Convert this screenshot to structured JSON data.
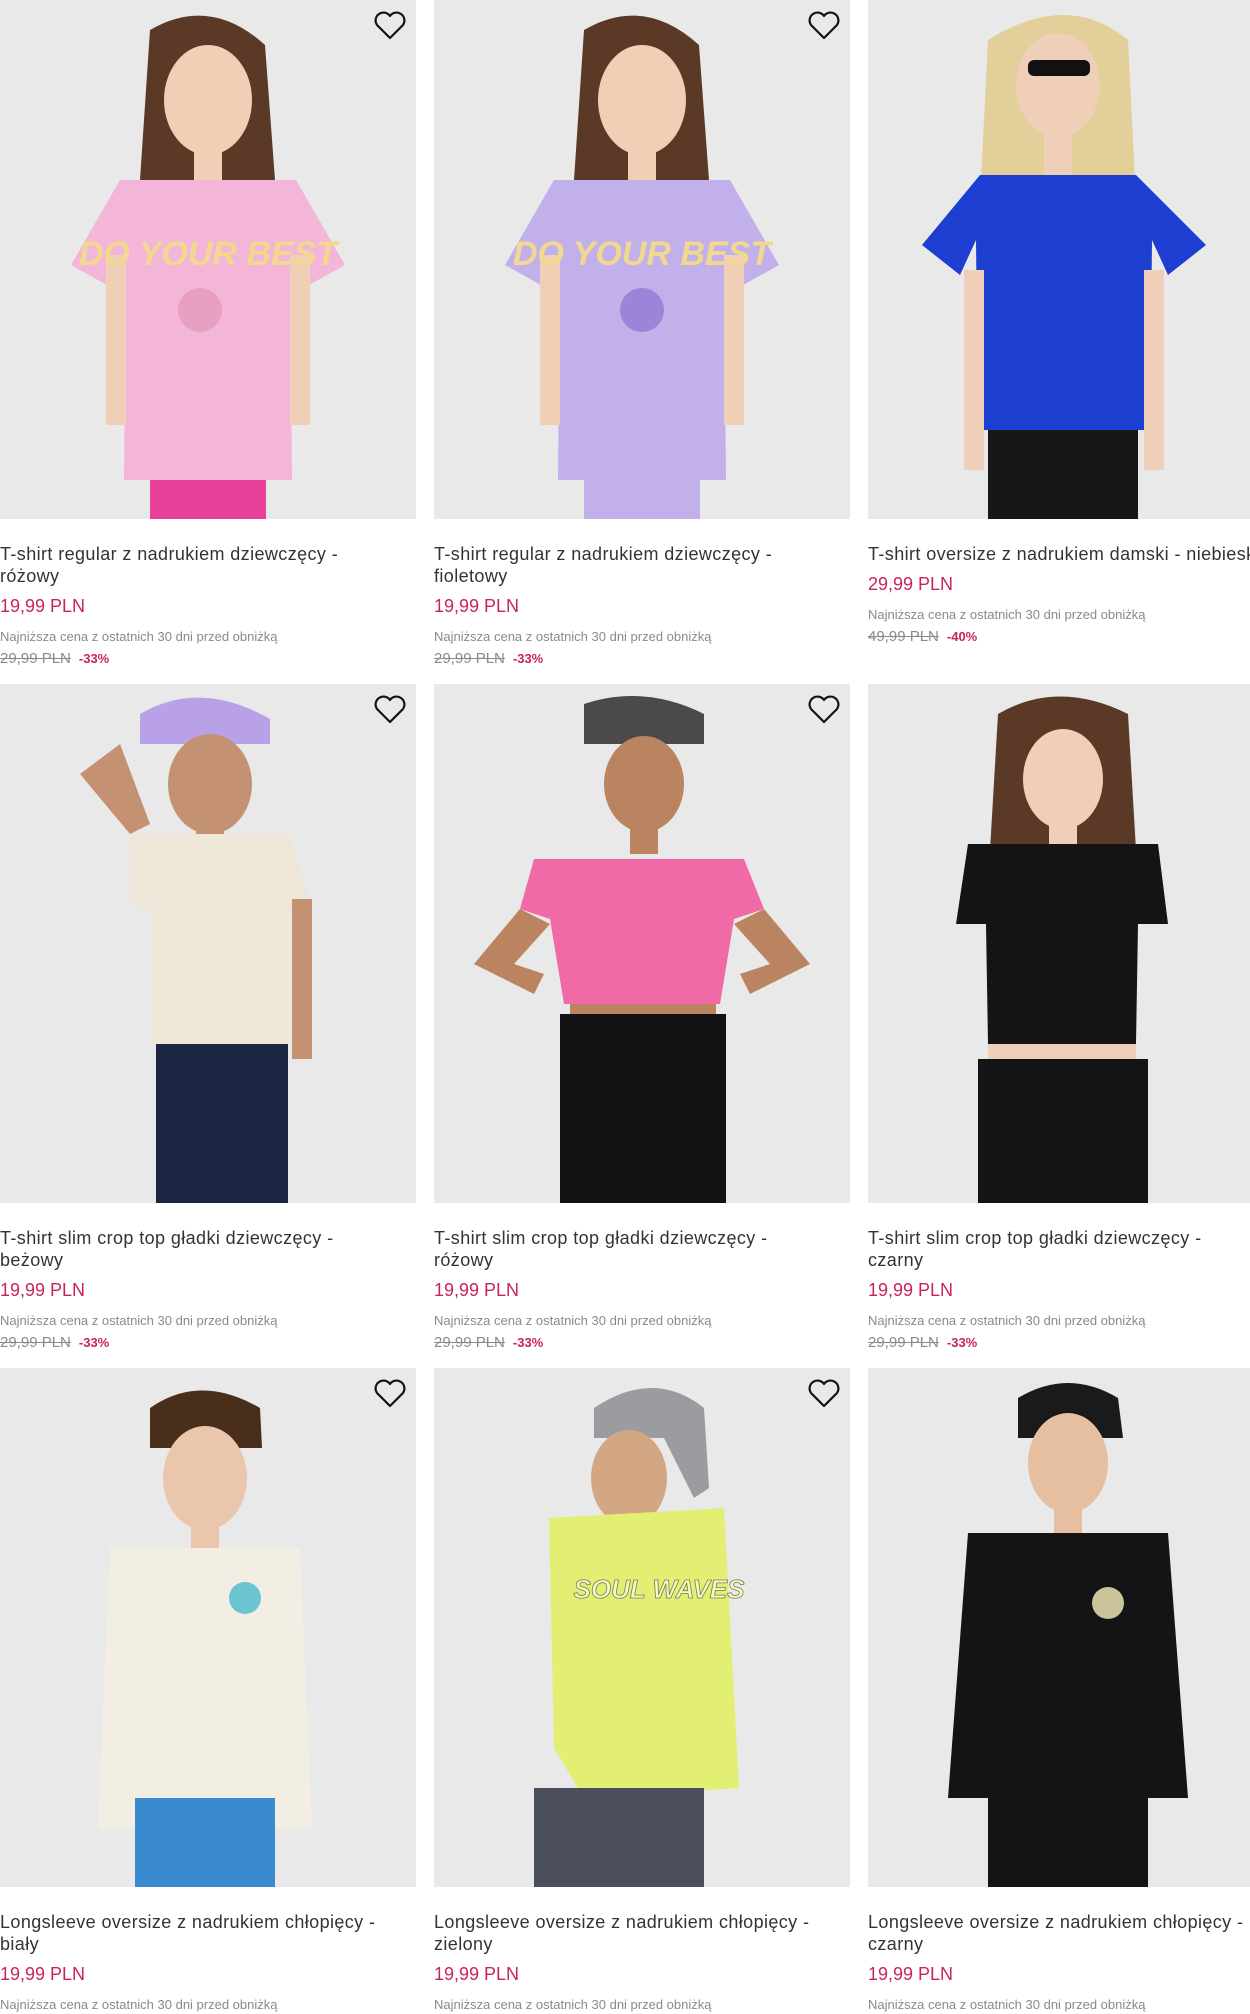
{
  "colors": {
    "price": "#c8245c",
    "discount": "#c8245c",
    "muted": "#8a8a8a",
    "title": "#333333",
    "image_bg": "#e9e9e9"
  },
  "icons": {
    "wishlist": "heart-outline-icon"
  },
  "products": [
    {
      "title": "T-shirt regular z nadrukiem dziewczęcy -\nróżowy",
      "price": "19,99 PLN",
      "lowest_label": "Najniższa cena z ostatnich 30 dni przed obniżką",
      "old_price": "29,99 PLN",
      "discount": "-33%",
      "shirt_color": "#f4b6d8",
      "bottom_color": "#e8409a",
      "print": "DO YOUR BEST"
    },
    {
      "title": "T-shirt regular z nadrukiem dziewczęcy -\nfioletowy",
      "price": "19,99 PLN",
      "lowest_label": "Najniższa cena z ostatnich 30 dni przed obniżką",
      "old_price": "29,99 PLN",
      "discount": "-33%",
      "shirt_color": "#c2b0ea",
      "bottom_color": "#c2b0ea",
      "print": "DO YOUR BEST"
    },
    {
      "title": "T-shirt oversize z nadrukiem damski - niebieski",
      "price": "29,99 PLN",
      "lowest_label": "Najniższa cena z ostatnich 30 dni przed obniżką",
      "old_price": "49,99 PLN",
      "discount": "-40%",
      "shirt_color": "#1d3fd1",
      "bottom_color": "#17171a"
    },
    {
      "title": "T-shirt slim crop top gładki dziewczęcy -\nbeżowy",
      "price": "19,99 PLN",
      "lowest_label": "Najniższa cena z ostatnich 30 dni przed obniżką",
      "old_price": "29,99 PLN",
      "discount": "-33%",
      "shirt_color": "#eee6d6",
      "bottom_color": "#1c2544",
      "cap_color": "#b8a1e6"
    },
    {
      "title": "T-shirt slim crop top gładki dziewczęcy -\nróżowy",
      "price": "19,99 PLN",
      "lowest_label": "Najniższa cena z ostatnich 30 dni przed obniżką",
      "old_price": "29,99 PLN",
      "discount": "-33%",
      "shirt_color": "#f06aa8",
      "bottom_color": "#121214",
      "cap_color": "#4a4a4a"
    },
    {
      "title": "T-shirt slim crop top gładki dziewczęcy -\nczarny",
      "price": "19,99 PLN",
      "lowest_label": "Najniższa cena z ostatnich 30 dni przed obniżką",
      "old_price": "29,99 PLN",
      "discount": "-33%",
      "shirt_color": "#141416",
      "bottom_color": "#141416"
    },
    {
      "title": "Longsleeve oversize z nadrukiem chłopięcy -\nbiały",
      "price": "19,99 PLN",
      "lowest_label": "Najniższa cena z ostatnich 30 dni przed obniżką",
      "shirt_color": "#f2eee4",
      "bottom_color": "#3a8ad0"
    },
    {
      "title": "Longsleeve oversize z nadrukiem chłopięcy -\nzielony",
      "price": "19,99 PLN",
      "lowest_label": "Najniższa cena z ostatnich 30 dni przed obniżką",
      "shirt_color": "#e2ef72",
      "bottom_color": "#4a4d5a",
      "cap_color": "#9a9ca0",
      "print": "SOUL WAVES"
    },
    {
      "title": "Longsleeve oversize z nadrukiem chłopięcy -\nczarny",
      "price": "19,99 PLN",
      "lowest_label": "Najniższa cena z ostatnich 30 dni przed obniżką",
      "shirt_color": "#141416",
      "bottom_color": "#141416"
    }
  ]
}
